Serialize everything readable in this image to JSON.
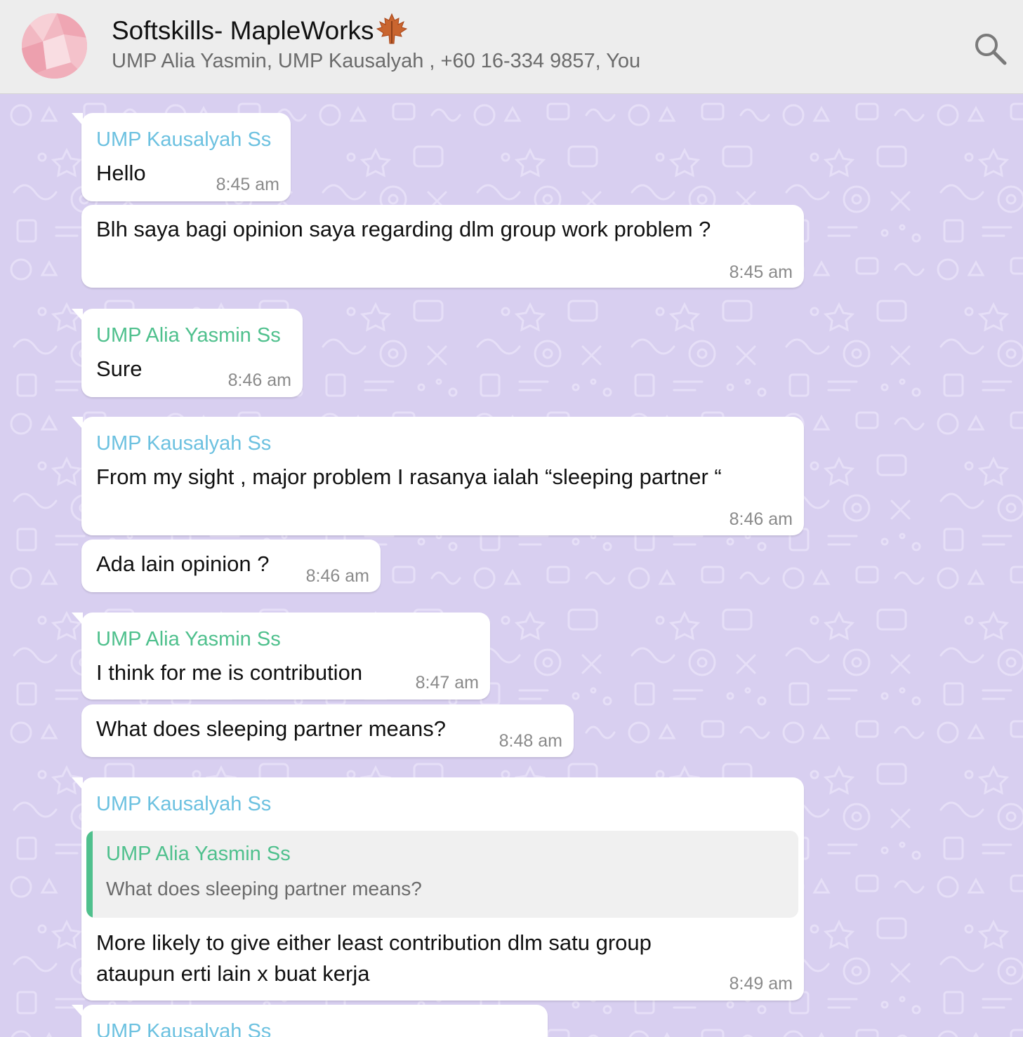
{
  "header": {
    "title": "Softskills- MapleWorks",
    "participants": "UMP Alia Yasmin, UMP Kausalyah , +60 16-334 9857, You",
    "search_icon": "search-icon",
    "leaf_icon": "maple-leaf-icon"
  },
  "colors": {
    "header_bg": "#ededed",
    "chat_bg": "#d8cff0",
    "bubble_bg": "#ffffff",
    "sender_kausalyah": "#6cc1e0",
    "sender_alia": "#4fc08d"
  },
  "messages": [
    {
      "sender": "UMP Kausalyah Ss",
      "text": "Hello",
      "time": "8:45 am"
    },
    {
      "text": "Blh saya bagi opinion saya regarding dlm group work problem ?",
      "time": "8:45 am"
    },
    {
      "sender": "UMP Alia Yasmin Ss",
      "text": "Sure",
      "time": "8:46 am"
    },
    {
      "sender": "UMP Kausalyah Ss",
      "text": "From my sight , major problem I rasanya ialah “sleeping partner “",
      "time": "8:46 am"
    },
    {
      "text": "Ada lain opinion ?",
      "time": "8:46 am"
    },
    {
      "sender": "UMP Alia Yasmin Ss",
      "text": "I think for me is contribution",
      "time": "8:47 am"
    },
    {
      "text": "What does sleeping partner means?",
      "time": "8:48 am"
    },
    {
      "sender": "UMP Kausalyah Ss",
      "quote": {
        "sender": "UMP Alia Yasmin Ss",
        "text": "What does sleeping partner means?"
      },
      "text_line1": "More likely to give either least contribution dlm satu group",
      "text_line2": "ataupun erti lain x buat kerja",
      "time": "8:49 am"
    },
    {
      "sender": "UMP Kausalyah Ss"
    }
  ]
}
